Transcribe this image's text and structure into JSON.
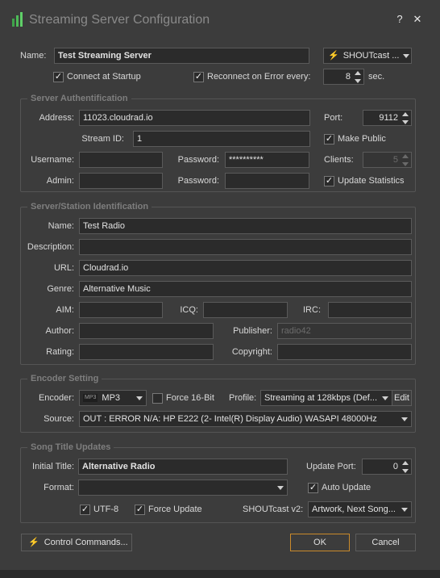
{
  "window": {
    "title": "Streaming Server Configuration",
    "help_label": "?",
    "close_label": "✕"
  },
  "top": {
    "name_label": "Name:",
    "name_value": "Test Streaming Server",
    "server_type": "SHOUTcast ...",
    "connect_startup_label": "Connect at Startup",
    "connect_startup_checked": true,
    "reconnect_label": "Reconnect on Error every:",
    "reconnect_checked": true,
    "reconnect_value": "8",
    "reconnect_unit": "sec."
  },
  "auth": {
    "title": "Server Authentification",
    "address_label": "Address:",
    "address_value": "11023.cloudrad.io",
    "port_label": "Port:",
    "port_value": "9112",
    "stream_id_label": "Stream ID:",
    "stream_id_value": "1",
    "make_public_label": "Make Public",
    "make_public_checked": true,
    "username_label": "Username:",
    "username_value": "",
    "password_label": "Password:",
    "password_value": "**********",
    "clients_label": "Clients:",
    "clients_value": "5",
    "admin_label": "Admin:",
    "admin_value": "",
    "admin_password_label": "Password:",
    "admin_password_value": "",
    "update_stats_label": "Update Statistics",
    "update_stats_checked": true
  },
  "station": {
    "title": "Server/Station Identification",
    "name_label": "Name:",
    "name_value": "Test Radio",
    "description_label": "Description:",
    "description_value": "",
    "url_label": "URL:",
    "url_value": "Cloudrad.io",
    "genre_label": "Genre:",
    "genre_value": "Alternative Music",
    "aim_label": "AIM:",
    "aim_value": "",
    "icq_label": "ICQ:",
    "icq_value": "",
    "irc_label": "IRC:",
    "irc_value": "",
    "author_label": "Author:",
    "author_value": "",
    "publisher_label": "Publisher:",
    "publisher_value": "radio42",
    "rating_label": "Rating:",
    "rating_value": "",
    "copyright_label": "Copyright:",
    "copyright_value": ""
  },
  "encoder": {
    "title": "Encoder Setting",
    "encoder_label": "Encoder:",
    "encoder_icon_text": "MP3",
    "encoder_value": "MP3",
    "force16_label": "Force 16-Bit",
    "force16_checked": false,
    "profile_label": "Profile:",
    "profile_value": "Streaming at 128kbps (Def...",
    "edit_label": "Edit",
    "source_label": "Source:",
    "source_value": "OUT  : ERROR N/A: HP E222 (2- Intel(R) Display Audio) WASAPI 48000Hz"
  },
  "song": {
    "title": "Song Title Updates",
    "initial_label": "Initial Title:",
    "initial_value": "Alternative Radio",
    "update_port_label": "Update Port:",
    "update_port_value": "0",
    "format_label": "Format:",
    "format_value": "",
    "auto_update_label": "Auto Update",
    "auto_update_checked": true,
    "utf8_label": "UTF-8",
    "utf8_checked": true,
    "force_update_label": "Force Update",
    "force_update_checked": true,
    "shoutcast_v2_label": "SHOUTcast v2:",
    "shoutcast_v2_value": "Artwork, Next Song..."
  },
  "footer": {
    "control_commands_label": "Control Commands...",
    "ok_label": "OK",
    "cancel_label": "Cancel"
  },
  "colors": {
    "background": "#3c3c3c",
    "field_background": "#2b2b2b",
    "accent_bolt": "#f2b12c",
    "ok_border": "#c98a2b",
    "group_title": "#7e7e7e"
  }
}
